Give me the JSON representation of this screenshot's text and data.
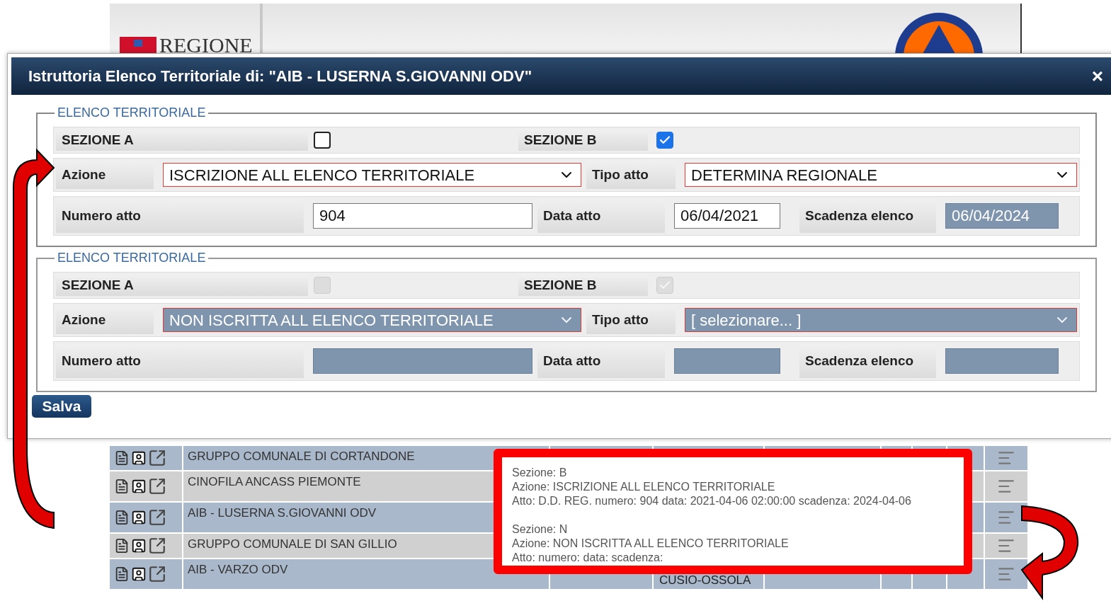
{
  "header": {
    "logo_text": "REGIONE"
  },
  "dialog": {
    "title": "Istruttoria Elenco Territoriale di: \"AIB - LUSERNA S.GIOVANNI ODV\"",
    "close": "×",
    "sections": [
      {
        "legend": "ELENCO TERRITORIALE",
        "disabled": false,
        "sezione_a": {
          "label": "SEZIONE A",
          "checked": false
        },
        "sezione_b": {
          "label": "SEZIONE B",
          "checked": true
        },
        "azione": {
          "label": "Azione",
          "value": "ISCRIZIONE ALL ELENCO TERRITORIALE"
        },
        "tipo_atto": {
          "label": "Tipo atto",
          "value": "DETERMINA REGIONALE"
        },
        "numero_atto": {
          "label": "Numero atto",
          "value": "904"
        },
        "data_atto": {
          "label": "Data atto",
          "value": "06/04/2021"
        },
        "scadenza": {
          "label": "Scadenza elenco",
          "value": "06/04/2024",
          "disabled": true
        }
      },
      {
        "legend": "ELENCO TERRITORIALE",
        "disabled": true,
        "sezione_a": {
          "label": "SEZIONE A",
          "checked": false
        },
        "sezione_b": {
          "label": "SEZIONE B",
          "checked": true
        },
        "azione": {
          "label": "Azione",
          "value": "NON ISCRITTA ALL ELENCO TERRITORIALE"
        },
        "tipo_atto": {
          "label": "Tipo atto",
          "value": "[ selezionare... ]"
        },
        "numero_atto": {
          "label": "Numero atto"
        },
        "data_atto": {
          "label": "Data atto"
        },
        "scadenza": {
          "label": "Scadenza elenco"
        }
      }
    ],
    "save_button": "Salva"
  },
  "table": {
    "rows": [
      {
        "name": "GRUPPO COMUNALE DI CORTANDONE"
      },
      {
        "name": "CINOFILA ANCASS PIEMONTE"
      },
      {
        "name": "AIB - LUSERNA S.GIOVANNI ODV"
      },
      {
        "name": "GRUPPO COMUNALE DI SAN GILLIO"
      },
      {
        "name": "AIB - VARZO ODV",
        "column_3": "CUSIO-OSSOLA"
      }
    ]
  },
  "tooltip": {
    "groups": [
      [
        "Sezione: B",
        "Azione: ISCRIZIONE ALL ELENCO TERRITORIALE",
        "Atto: D.D. REG. numero: 904 data: 2021-04-06 02:00:00 scadenza: 2024-04-06"
      ],
      [
        "Sezione: N",
        "Azione: NON ISCRITTA ALL ELENCO TERRITORIALE",
        "Atto: numero: data: scadenza:"
      ]
    ]
  }
}
